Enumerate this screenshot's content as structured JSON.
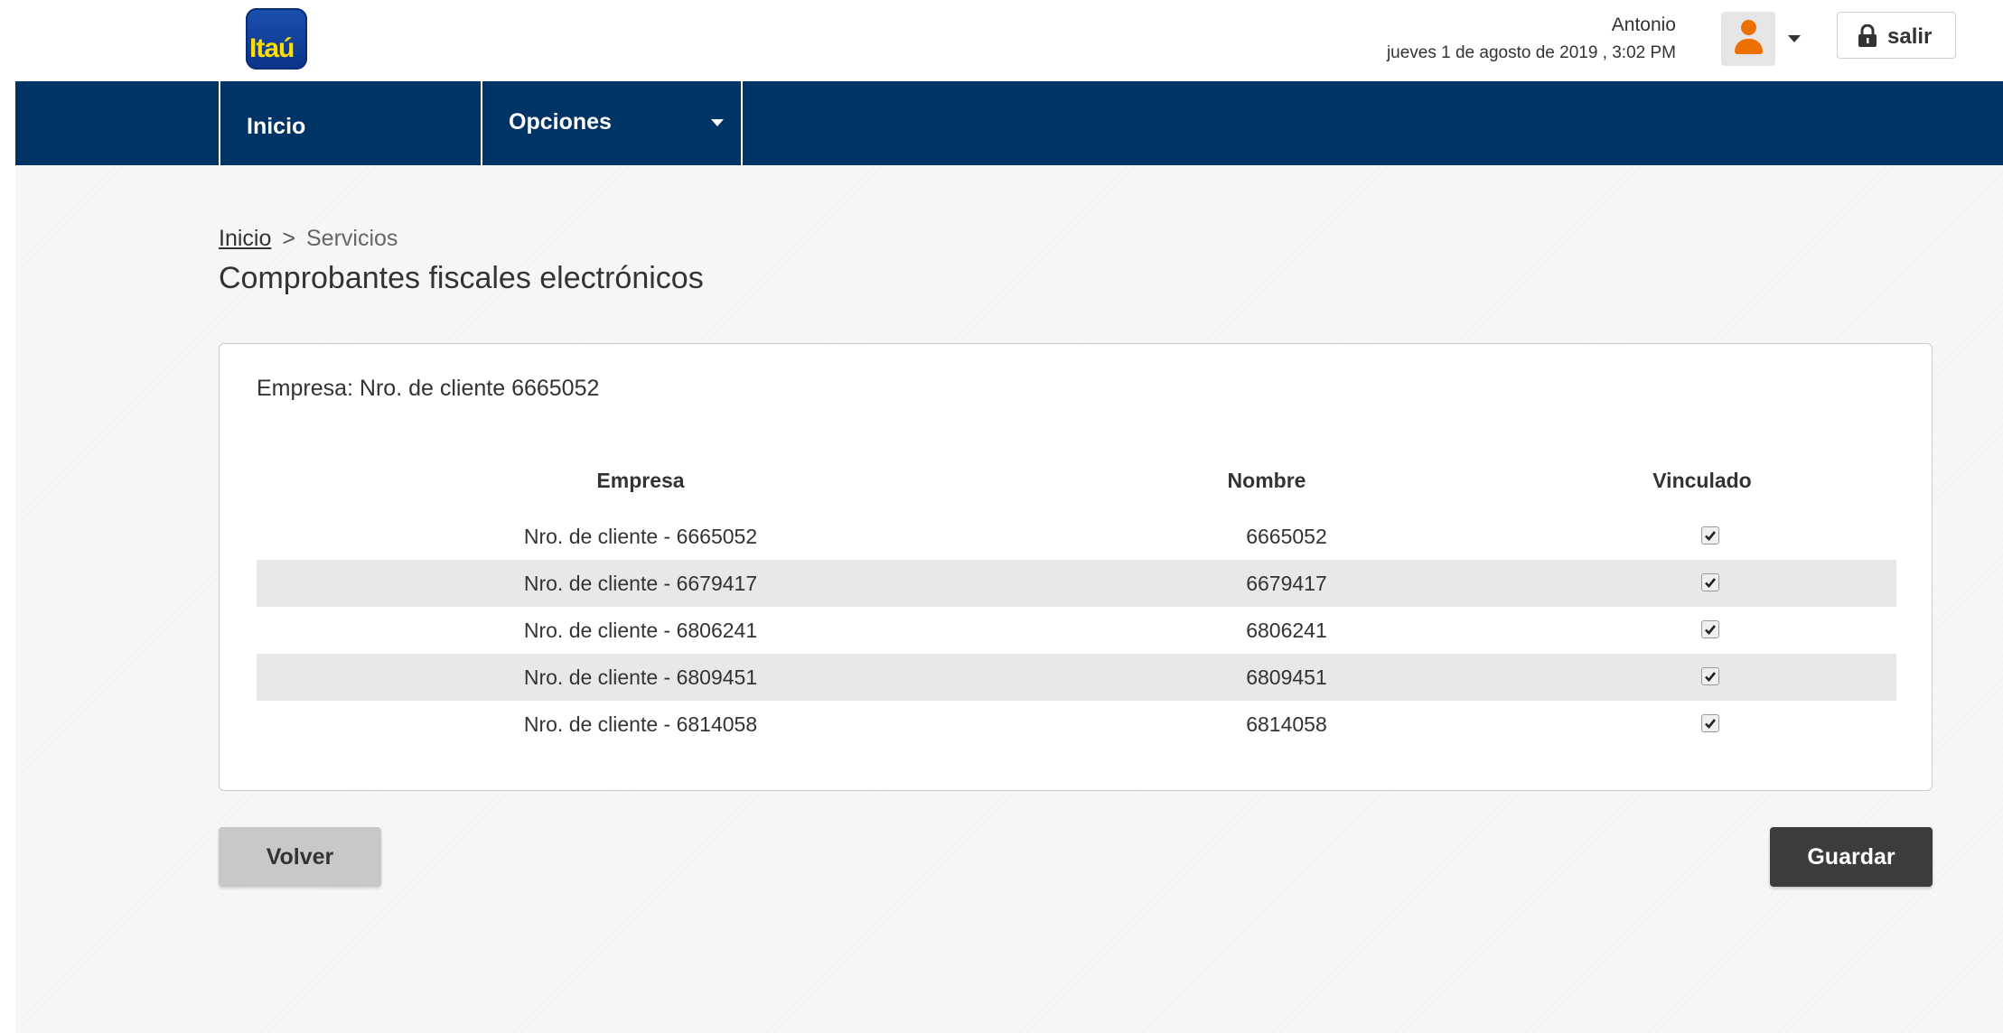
{
  "header": {
    "logo_text": "Itaú",
    "user_name": "Antonio",
    "date_time": "jueves 1 de agosto de 2019 , 3:02 PM",
    "logout_label": "salir"
  },
  "nav": {
    "items": [
      {
        "label": "Inicio"
      },
      {
        "label": "Opciones"
      }
    ]
  },
  "breadcrumb": {
    "link": "Inicio",
    "separator": ">",
    "current": "Servicios"
  },
  "page_title": "Comprobantes fiscales electrónicos",
  "card": {
    "heading": "Empresa: Nro. de cliente 6665052",
    "columns": [
      "Empresa",
      "Nombre",
      "Vinculado"
    ],
    "rows": [
      {
        "empresa": "Nro. de cliente - 6665052",
        "nombre": "6665052",
        "vinculado": true
      },
      {
        "empresa": "Nro. de cliente - 6679417",
        "nombre": "6679417",
        "vinculado": true
      },
      {
        "empresa": "Nro. de cliente - 6806241",
        "nombre": "6806241",
        "vinculado": true
      },
      {
        "empresa": "Nro. de cliente - 6809451",
        "nombre": "6809451",
        "vinculado": true
      },
      {
        "empresa": "Nro. de cliente - 6814058",
        "nombre": "6814058",
        "vinculado": true
      }
    ]
  },
  "actions": {
    "back_label": "Volver",
    "save_label": "Guardar"
  },
  "colors": {
    "nav_bg": "#003366",
    "brand_orange": "#ec7000",
    "logo_blue": "#0b3388",
    "logo_yellow": "#ffdd00",
    "save_bg": "#3c3c3c",
    "back_bg": "#c8c8c8"
  },
  "icons": {
    "logout": "lock-icon",
    "avatar": "user-icon",
    "dropdown": "caret-down-icon",
    "check": "check-icon"
  }
}
